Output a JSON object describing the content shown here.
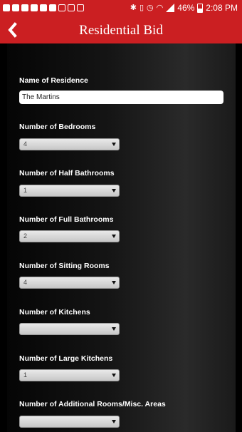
{
  "status_bar": {
    "battery": "46%",
    "time": "2:08 PM"
  },
  "header": {
    "title": "Residential Bid",
    "back_icon": "chevron-left-icon"
  },
  "form": {
    "residence_name": {
      "label": "Name of Residence",
      "value": "The Martins"
    },
    "fields": [
      {
        "label": "Number of Bedrooms",
        "value": "4"
      },
      {
        "label": "Number of Half Bathrooms",
        "value": "1"
      },
      {
        "label": "Number of Full Bathrooms",
        "value": "2"
      },
      {
        "label": "Number of Sitting Rooms",
        "value": "4"
      },
      {
        "label": "Number of Kitchens",
        "value": ""
      },
      {
        "label": "Number of Large Kitchens",
        "value": "1"
      },
      {
        "label": "Number of Additional Rooms/Misc. Areas",
        "value": ""
      }
    ]
  },
  "colors": {
    "accent": "#cb1f22",
    "background": "#000000"
  }
}
